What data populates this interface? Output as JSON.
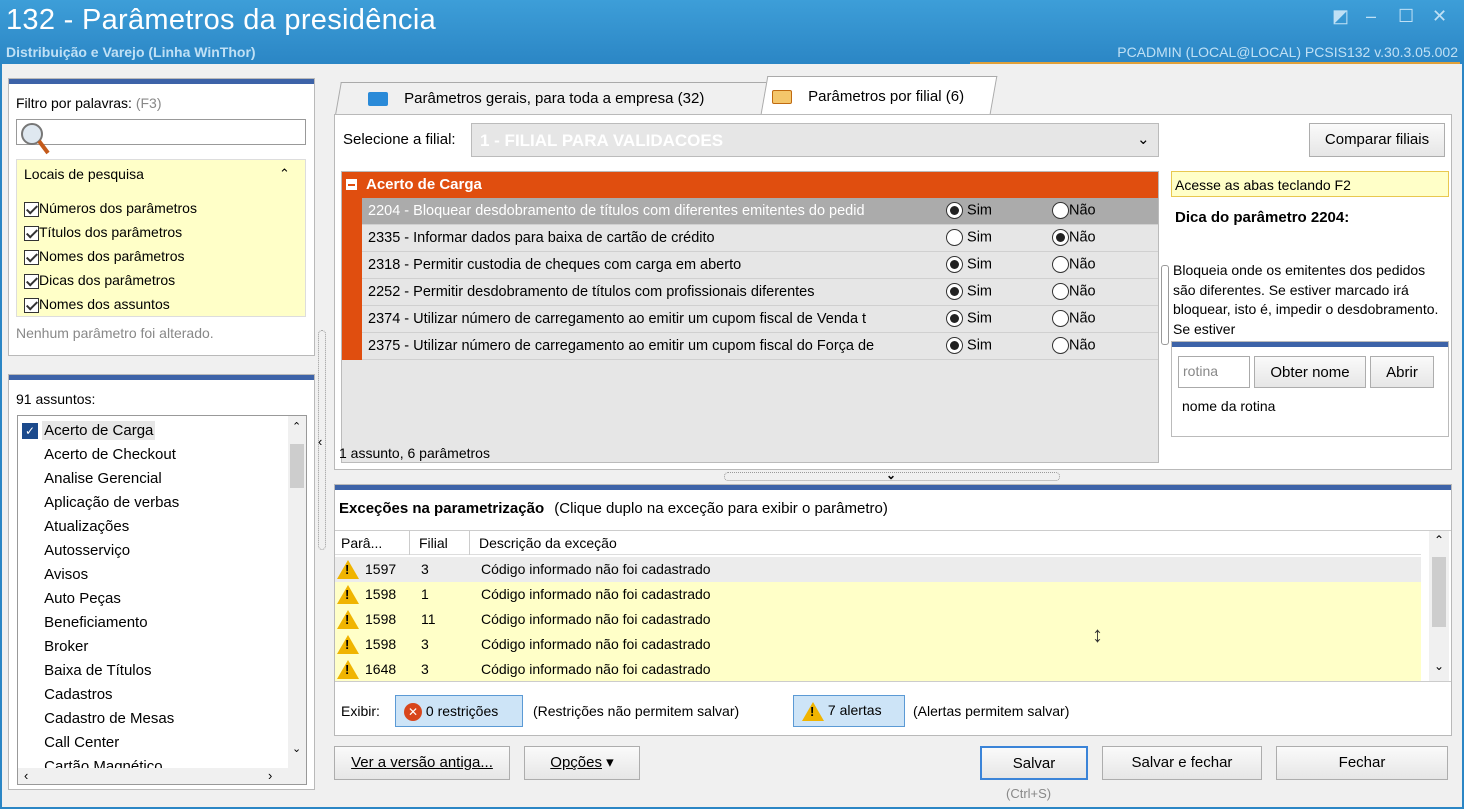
{
  "window": {
    "title": "132 - Parâmetros da presidência",
    "subtitle": "Distribuição e Varejo (Linha WinThor)",
    "user_info": "PCADMIN (LOCAL@LOCAL)  PCSIS132  v.30.3.05.002"
  },
  "filter": {
    "label": "Filtro por palavras:",
    "shortcut": "(F3)",
    "search_value": "",
    "locais_title": "Locais de pesquisa",
    "options": [
      {
        "label": "Números dos parâmetros",
        "checked": true
      },
      {
        "label": "Títulos dos parâmetros",
        "checked": true
      },
      {
        "label": "Nomes dos parâmetros",
        "checked": true
      },
      {
        "label": "Dicas dos parâmetros",
        "checked": true
      },
      {
        "label": "Nomes dos assuntos",
        "checked": true
      }
    ],
    "status": "Nenhum parâmetro foi alterado."
  },
  "subjects": {
    "count_label": "91 assuntos:",
    "items": [
      "Acerto de Carga",
      "Acerto de Checkout",
      "Analise Gerencial",
      "Aplicação de verbas",
      "Atualizações",
      "Autosserviço",
      "Avisos",
      "Auto Peças",
      "Beneficiamento",
      "Broker",
      "Baixa de Títulos",
      "Cadastros",
      "Cadastro de Mesas",
      "Call Center",
      "Cartão Magnético"
    ],
    "selected": "Acerto de Carga"
  },
  "tabs": [
    {
      "label": "Parâmetros gerais, para toda a empresa",
      "count": "(32)",
      "active": false
    },
    {
      "label": "Parâmetros por filial",
      "count": "(6)",
      "active": true
    }
  ],
  "filial": {
    "label": "Selecione a filial:",
    "value": "1 - FILIAL PARA VALIDACOES",
    "compare_button": "Comparar filiais"
  },
  "group": {
    "title": "Acerto de Carga",
    "sim": "Sim",
    "nao": "Não",
    "params": [
      {
        "text": "2204 - Bloquear desdobramento de títulos com diferentes emitentes do pedid",
        "value": "sim",
        "selected": true
      },
      {
        "text": "2335 - Informar dados para baixa de cartão de crédito",
        "value": "nao",
        "selected": false
      },
      {
        "text": "2318 - Permitir custodia de cheques com carga em aberto",
        "value": "sim",
        "selected": false
      },
      {
        "text": "2252 - Permitir desdobramento de títulos com profissionais diferentes",
        "value": "sim",
        "selected": false
      },
      {
        "text": "2374 - Utilizar número de carregamento ao emitir um cupom fiscal de Venda t",
        "value": "sim",
        "selected": false
      },
      {
        "text": "2375 - Utilizar número de carregamento ao emitir um cupom fiscal do Força de",
        "value": "sim",
        "selected": false
      }
    ],
    "summary": "1 assunto, 6 parâmetros"
  },
  "tip": {
    "hint": "Acesse as abas teclando F2",
    "title": "Dica do parâmetro 2204:",
    "text": "Bloqueia onde os emitentes dos pedidos são diferentes. Se estiver marcado irá bloquear, isto é, impedir o desdobramento. Se estiver",
    "rotina_placeholder": "rotina",
    "obter_button": "Obter nome",
    "abrir_button": "Abrir",
    "rotina_name": "nome da rotina"
  },
  "exceptions": {
    "title": "Exceções na parametrização",
    "subtitle": "(Clique duplo na exceção para exibir o parâmetro)",
    "columns": [
      "Parâ...",
      "Filial",
      "Descrição da exceção"
    ],
    "rows": [
      {
        "param": "1597",
        "filial": "3",
        "desc": "Código informado não foi cadastrado"
      },
      {
        "param": "1598",
        "filial": "1",
        "desc": "Código informado não foi cadastrado"
      },
      {
        "param": "1598",
        "filial": "11",
        "desc": "Código informado não foi cadastrado"
      },
      {
        "param": "1598",
        "filial": "3",
        "desc": "Código informado não foi cadastrado"
      },
      {
        "param": "1648",
        "filial": "3",
        "desc": "Código informado não foi cadastrado"
      }
    ],
    "exibir_label": "Exibir:",
    "restricoes": "0 restrições",
    "restricoes_note": "(Restrições não permitem salvar)",
    "alertas": "7 alertas",
    "alertas_note": "(Alertas permitem salvar)"
  },
  "footer": {
    "old_version": "Ver a versão antiga...",
    "options": "Opções",
    "save": "Salvar",
    "save_shortcut": "(Ctrl+S)",
    "save_close": "Salvar e fechar",
    "close": "Fechar"
  },
  "colors": {
    "accent": "#e04e0f",
    "titlebar": "#2b86c5",
    "yellow": "#ffffc8"
  }
}
